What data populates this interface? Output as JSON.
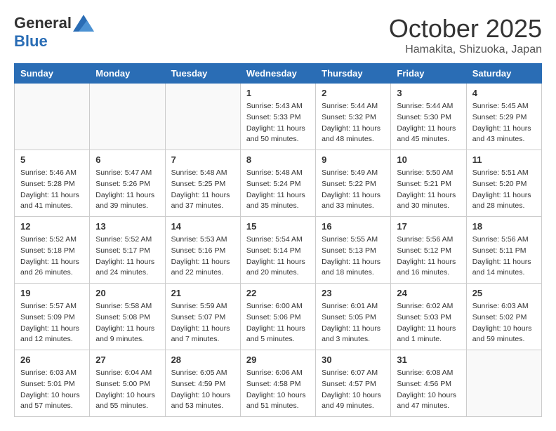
{
  "logo": {
    "general": "General",
    "blue": "Blue"
  },
  "title": {
    "month": "October 2025",
    "location": "Hamakita, Shizuoka, Japan"
  },
  "weekdays": [
    "Sunday",
    "Monday",
    "Tuesday",
    "Wednesday",
    "Thursday",
    "Friday",
    "Saturday"
  ],
  "weeks": [
    [
      {
        "day": "",
        "info": ""
      },
      {
        "day": "",
        "info": ""
      },
      {
        "day": "",
        "info": ""
      },
      {
        "day": "1",
        "info": "Sunrise: 5:43 AM\nSunset: 5:33 PM\nDaylight: 11 hours\nand 50 minutes."
      },
      {
        "day": "2",
        "info": "Sunrise: 5:44 AM\nSunset: 5:32 PM\nDaylight: 11 hours\nand 48 minutes."
      },
      {
        "day": "3",
        "info": "Sunrise: 5:44 AM\nSunset: 5:30 PM\nDaylight: 11 hours\nand 45 minutes."
      },
      {
        "day": "4",
        "info": "Sunrise: 5:45 AM\nSunset: 5:29 PM\nDaylight: 11 hours\nand 43 minutes."
      }
    ],
    [
      {
        "day": "5",
        "info": "Sunrise: 5:46 AM\nSunset: 5:28 PM\nDaylight: 11 hours\nand 41 minutes."
      },
      {
        "day": "6",
        "info": "Sunrise: 5:47 AM\nSunset: 5:26 PM\nDaylight: 11 hours\nand 39 minutes."
      },
      {
        "day": "7",
        "info": "Sunrise: 5:48 AM\nSunset: 5:25 PM\nDaylight: 11 hours\nand 37 minutes."
      },
      {
        "day": "8",
        "info": "Sunrise: 5:48 AM\nSunset: 5:24 PM\nDaylight: 11 hours\nand 35 minutes."
      },
      {
        "day": "9",
        "info": "Sunrise: 5:49 AM\nSunset: 5:22 PM\nDaylight: 11 hours\nand 33 minutes."
      },
      {
        "day": "10",
        "info": "Sunrise: 5:50 AM\nSunset: 5:21 PM\nDaylight: 11 hours\nand 30 minutes."
      },
      {
        "day": "11",
        "info": "Sunrise: 5:51 AM\nSunset: 5:20 PM\nDaylight: 11 hours\nand 28 minutes."
      }
    ],
    [
      {
        "day": "12",
        "info": "Sunrise: 5:52 AM\nSunset: 5:18 PM\nDaylight: 11 hours\nand 26 minutes."
      },
      {
        "day": "13",
        "info": "Sunrise: 5:52 AM\nSunset: 5:17 PM\nDaylight: 11 hours\nand 24 minutes."
      },
      {
        "day": "14",
        "info": "Sunrise: 5:53 AM\nSunset: 5:16 PM\nDaylight: 11 hours\nand 22 minutes."
      },
      {
        "day": "15",
        "info": "Sunrise: 5:54 AM\nSunset: 5:14 PM\nDaylight: 11 hours\nand 20 minutes."
      },
      {
        "day": "16",
        "info": "Sunrise: 5:55 AM\nSunset: 5:13 PM\nDaylight: 11 hours\nand 18 minutes."
      },
      {
        "day": "17",
        "info": "Sunrise: 5:56 AM\nSunset: 5:12 PM\nDaylight: 11 hours\nand 16 minutes."
      },
      {
        "day": "18",
        "info": "Sunrise: 5:56 AM\nSunset: 5:11 PM\nDaylight: 11 hours\nand 14 minutes."
      }
    ],
    [
      {
        "day": "19",
        "info": "Sunrise: 5:57 AM\nSunset: 5:09 PM\nDaylight: 11 hours\nand 12 minutes."
      },
      {
        "day": "20",
        "info": "Sunrise: 5:58 AM\nSunset: 5:08 PM\nDaylight: 11 hours\nand 9 minutes."
      },
      {
        "day": "21",
        "info": "Sunrise: 5:59 AM\nSunset: 5:07 PM\nDaylight: 11 hours\nand 7 minutes."
      },
      {
        "day": "22",
        "info": "Sunrise: 6:00 AM\nSunset: 5:06 PM\nDaylight: 11 hours\nand 5 minutes."
      },
      {
        "day": "23",
        "info": "Sunrise: 6:01 AM\nSunset: 5:05 PM\nDaylight: 11 hours\nand 3 minutes."
      },
      {
        "day": "24",
        "info": "Sunrise: 6:02 AM\nSunset: 5:03 PM\nDaylight: 11 hours\nand 1 minute."
      },
      {
        "day": "25",
        "info": "Sunrise: 6:03 AM\nSunset: 5:02 PM\nDaylight: 10 hours\nand 59 minutes."
      }
    ],
    [
      {
        "day": "26",
        "info": "Sunrise: 6:03 AM\nSunset: 5:01 PM\nDaylight: 10 hours\nand 57 minutes."
      },
      {
        "day": "27",
        "info": "Sunrise: 6:04 AM\nSunset: 5:00 PM\nDaylight: 10 hours\nand 55 minutes."
      },
      {
        "day": "28",
        "info": "Sunrise: 6:05 AM\nSunset: 4:59 PM\nDaylight: 10 hours\nand 53 minutes."
      },
      {
        "day": "29",
        "info": "Sunrise: 6:06 AM\nSunset: 4:58 PM\nDaylight: 10 hours\nand 51 minutes."
      },
      {
        "day": "30",
        "info": "Sunrise: 6:07 AM\nSunset: 4:57 PM\nDaylight: 10 hours\nand 49 minutes."
      },
      {
        "day": "31",
        "info": "Sunrise: 6:08 AM\nSunset: 4:56 PM\nDaylight: 10 hours\nand 47 minutes."
      },
      {
        "day": "",
        "info": ""
      }
    ]
  ]
}
